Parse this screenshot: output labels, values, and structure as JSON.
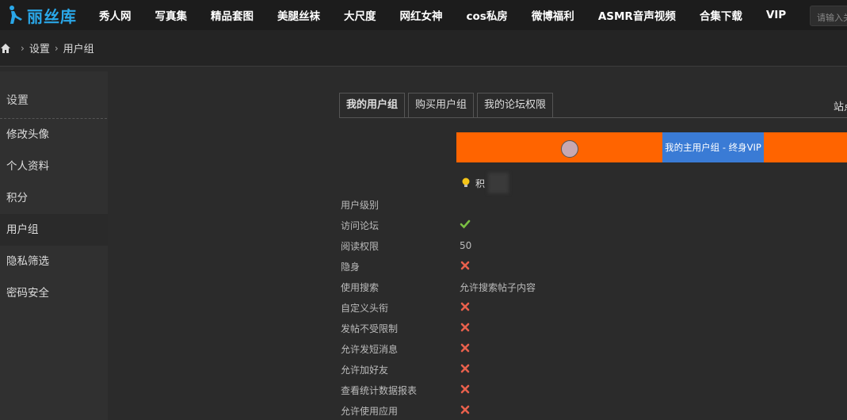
{
  "brand": {
    "name": "丽丝库"
  },
  "nav": [
    "秀人网",
    "写真集",
    "精品套图",
    "美腿丝袜",
    "大尺度",
    "网红女神",
    "cos私房",
    "微博福利",
    "ASMR音声视频",
    "合集下载",
    "VIP"
  ],
  "search": {
    "placeholder": "请输入关键词"
  },
  "breadcrumb": {
    "items": [
      "设置",
      "用户组"
    ]
  },
  "sidebar": {
    "title": "设置",
    "items": [
      "修改头像",
      "个人资料",
      "积分",
      "用户组",
      "隐私筛选",
      "密码安全"
    ],
    "active": "用户组"
  },
  "tabs": [
    {
      "label": "我的用户组",
      "active": true
    },
    {
      "label": "购买用户组",
      "active": false
    },
    {
      "label": "我的论坛权限",
      "active": false
    }
  ],
  "header_right": "站点",
  "banner": {
    "label": "我的主用户组 - 终身VIP",
    "color": "#ff6400",
    "label_bg": "#3a7bd5"
  },
  "points": {
    "label": "积"
  },
  "permissions": [
    {
      "label": "用户级别",
      "value": "",
      "icon": ""
    },
    {
      "label": "访问论坛",
      "value": "",
      "icon": "check"
    },
    {
      "label": "阅读权限",
      "value": "50",
      "icon": ""
    },
    {
      "label": "隐身",
      "value": "",
      "icon": "cross"
    },
    {
      "label": "使用搜索",
      "value": "允许搜索帖子内容",
      "icon": ""
    },
    {
      "label": "自定义头衔",
      "value": "",
      "icon": "cross"
    },
    {
      "label": "发帖不受限制",
      "value": "",
      "icon": "cross"
    },
    {
      "label": "允许发短消息",
      "value": "",
      "icon": "cross"
    },
    {
      "label": "允许加好友",
      "value": "",
      "icon": "cross"
    },
    {
      "label": "查看统计数据报表",
      "value": "",
      "icon": "cross"
    },
    {
      "label": "允许使用应用",
      "value": "",
      "icon": "cross"
    }
  ]
}
